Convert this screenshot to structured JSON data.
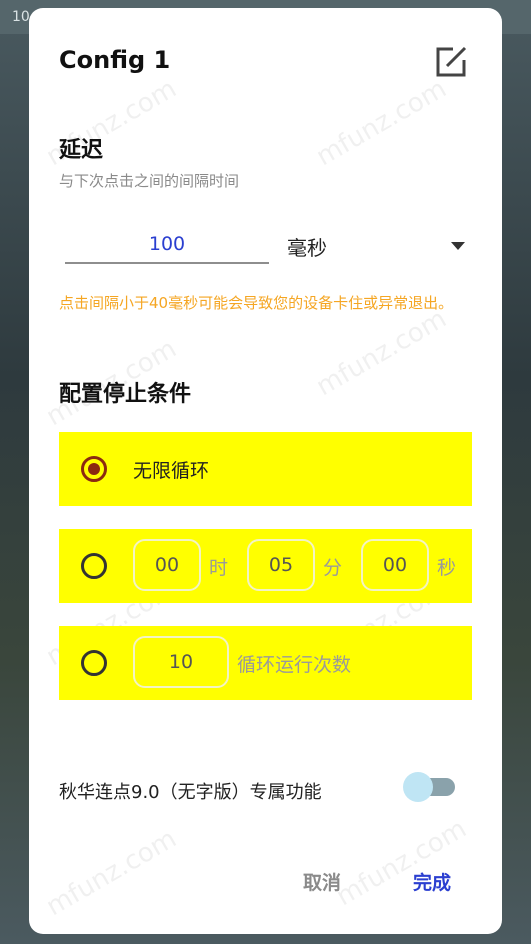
{
  "status": {
    "time": "10"
  },
  "dialog": {
    "title": "Config 1",
    "delay": {
      "heading": "延迟",
      "subtitle": "与下次点击之间的间隔时间",
      "value": "100",
      "unit": "毫秒",
      "warning": "点击间隔小于40毫秒可能会导致您的设备卡住或异常退出。"
    },
    "stop": {
      "heading": "配置停止条件",
      "options": [
        {
          "label": "无限循环",
          "selected": true
        },
        {
          "hours": "00",
          "hours_unit": "时",
          "minutes": "05",
          "minutes_unit": "分",
          "seconds": "00",
          "seconds_unit": "秒",
          "selected": false
        },
        {
          "count": "10",
          "count_label": "循环运行次数",
          "selected": false
        }
      ]
    },
    "feature": {
      "label": "秋华连点9.0（无字版）专属功能",
      "enabled": false
    },
    "buttons": {
      "cancel": "取消",
      "done": "完成"
    },
    "watermark": "mfunz.com"
  },
  "colors": {
    "accent": "#2b3fd0",
    "warning": "#f5a623",
    "highlight": "#ffff00",
    "radio_checked": "#8b2a10"
  }
}
